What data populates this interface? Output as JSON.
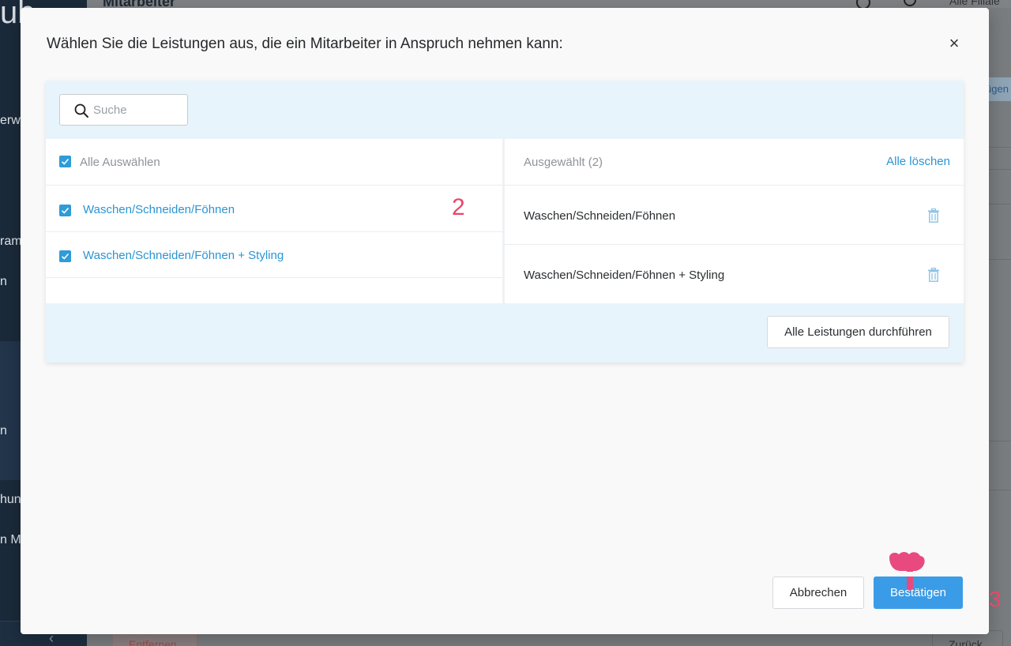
{
  "background": {
    "app_logo": "ub",
    "sidebar_items": [
      "erwa",
      "ram",
      "n",
      "n",
      "hun",
      "n Mg"
    ],
    "page_title": "Mitarbeiter",
    "top_right_text": "Alle Filiale",
    "right_button_text": "ügen",
    "remove_label": "Entfernen",
    "back_label": "Zurück"
  },
  "modal": {
    "title": "Wählen Sie die Leistungen aus, die ein Mitarbeiter in Anspruch nehmen kann:",
    "close_symbol": "×",
    "search": {
      "placeholder": "Suche",
      "value": ""
    },
    "left": {
      "select_all_label": "Alle Auswählen",
      "select_all_checked": true,
      "items": [
        {
          "label": "Waschen/Schneiden/Föhnen",
          "checked": true
        },
        {
          "label": "Waschen/Schneiden/Föhnen + Styling",
          "checked": true
        }
      ]
    },
    "right": {
      "selected_header": "Ausgewählt (2)",
      "clear_all_label": "Alle löschen",
      "items": [
        {
          "label": "Waschen/Schneiden/Föhnen"
        },
        {
          "label": "Waschen/Schneiden/Föhnen + Styling"
        }
      ]
    },
    "perform_all_label": "Alle Leistungen durchführen",
    "cancel_label": "Abbrechen",
    "confirm_label": "Bestätigen"
  },
  "annotations": {
    "step2": "2",
    "step3": "3"
  },
  "colors": {
    "accent": "#2a95d4",
    "confirm_bg": "#3a9ce6",
    "panel_tint": "#e8f4fb",
    "annotation": "#e8466b",
    "sidebar_bg": "#1b2a3a"
  },
  "icons": {
    "search": "search-icon",
    "close": "close-icon",
    "checkbox": "checkbox-checked-icon",
    "trash": "trash-icon",
    "pointer": "pointing-hand-icon",
    "collapse": "chevron-left-icon"
  }
}
